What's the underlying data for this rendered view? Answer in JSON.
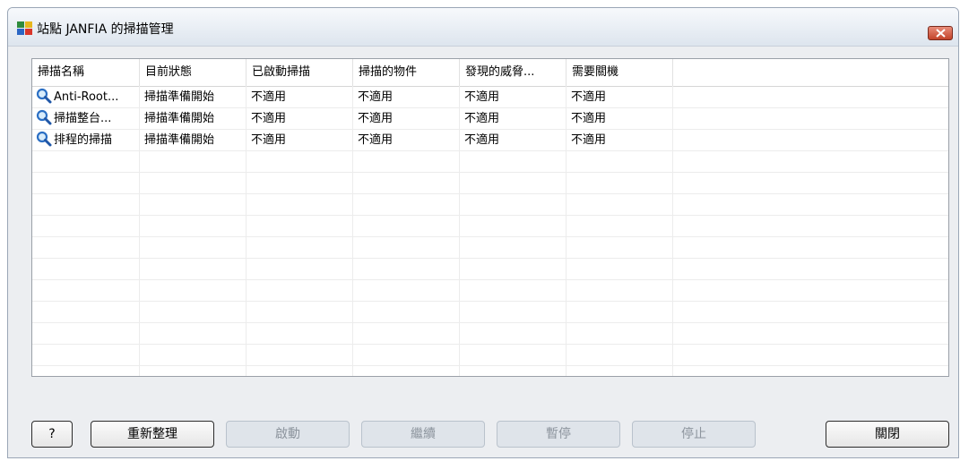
{
  "window": {
    "title": "站點 JANFIA 的掃描管理",
    "accent_color": "#c2432a"
  },
  "table": {
    "columns": [
      "掃描名稱",
      "目前狀態",
      "已啟動掃描",
      "掃描的物件",
      "發現的威脅...",
      "需要關機"
    ],
    "rows": [
      {
        "name": "Anti-Root...",
        "status": "掃描準備開始",
        "started": "不適用",
        "objects": "不適用",
        "threats": "不適用",
        "reboot": "不適用",
        "icon": "search-icon"
      },
      {
        "name": "掃描整台...",
        "status": "掃描準備開始",
        "started": "不適用",
        "objects": "不適用",
        "threats": "不適用",
        "reboot": "不適用",
        "icon": "search-icon"
      },
      {
        "name": "排程的掃描",
        "status": "掃描準備開始",
        "started": "不適用",
        "objects": "不適用",
        "threats": "不適用",
        "reboot": "不適用",
        "icon": "search-icon"
      }
    ]
  },
  "buttons": {
    "help": "?",
    "refresh": "重新整理",
    "start": "啟動",
    "resume": "繼續",
    "pause": "暫停",
    "stop": "停止",
    "close": "關閉"
  }
}
